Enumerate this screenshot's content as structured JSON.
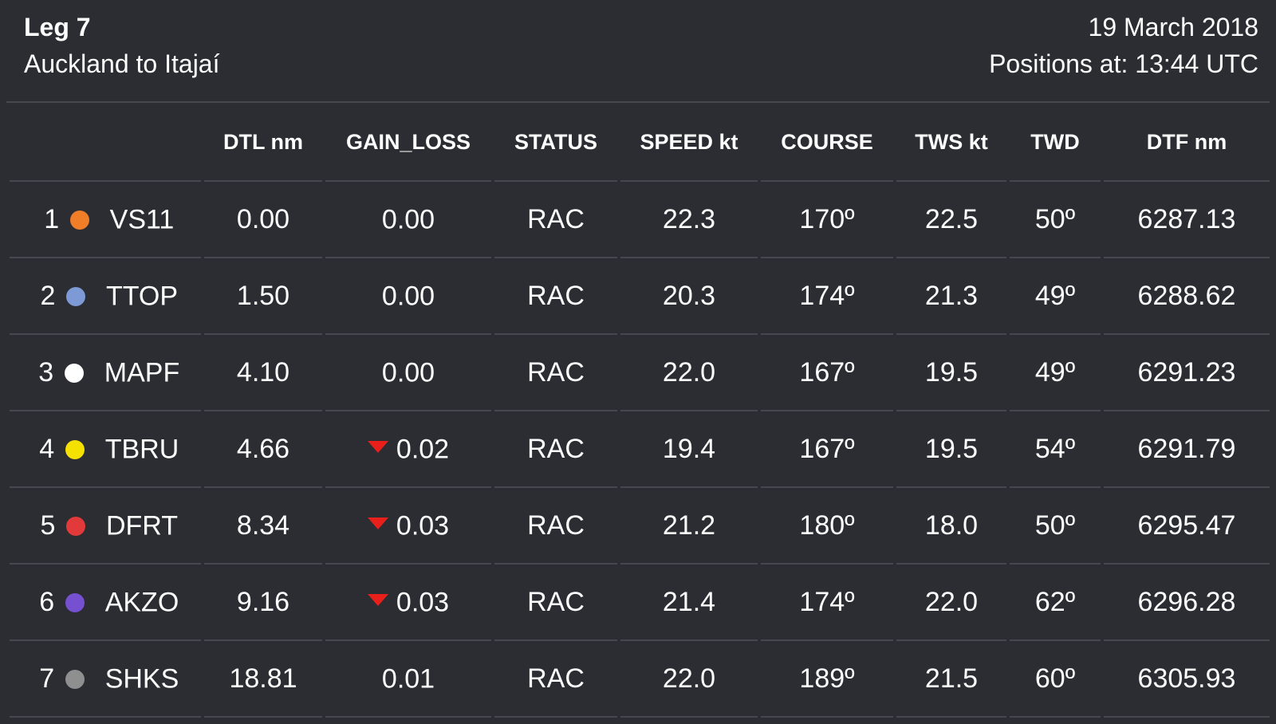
{
  "header": {
    "leg": "Leg 7",
    "route": "Auckland to Itajaí",
    "date": "19 March 2018",
    "positions_at": "Positions at: 13:44 UTC"
  },
  "columns": [
    "DTL nm",
    "GAIN_LOSS",
    "STATUS",
    "SPEED kt",
    "COURSE",
    "TWS kt",
    "TWD",
    "DTF nm"
  ],
  "rows": [
    {
      "rank": "1",
      "boat": "VS11",
      "color": "#f07d28",
      "dtl": "0.00",
      "gain_loss": "0.00",
      "loss": false,
      "status": "RAC",
      "speed": "22.3",
      "course": "170º",
      "tws": "22.5",
      "twd": "50º",
      "dtf": "6287.13"
    },
    {
      "rank": "2",
      "boat": "TTOP",
      "color": "#7e9ad6",
      "dtl": "1.50",
      "gain_loss": "0.00",
      "loss": false,
      "status": "RAC",
      "speed": "20.3",
      "course": "174º",
      "tws": "21.3",
      "twd": "49º",
      "dtf": "6288.62"
    },
    {
      "rank": "3",
      "boat": "MAPF",
      "color": "#ffffff",
      "dtl": "4.10",
      "gain_loss": "0.00",
      "loss": false,
      "status": "RAC",
      "speed": "22.0",
      "course": "167º",
      "tws": "19.5",
      "twd": "49º",
      "dtf": "6291.23"
    },
    {
      "rank": "4",
      "boat": "TBRU",
      "color": "#f5e100",
      "dtl": "4.66",
      "gain_loss": "0.02",
      "loss": true,
      "status": "RAC",
      "speed": "19.4",
      "course": "167º",
      "tws": "19.5",
      "twd": "54º",
      "dtf": "6291.79"
    },
    {
      "rank": "5",
      "boat": "DFRT",
      "color": "#e23a3a",
      "dtl": "8.34",
      "gain_loss": "0.03",
      "loss": true,
      "status": "RAC",
      "speed": "21.2",
      "course": "180º",
      "tws": "18.0",
      "twd": "50º",
      "dtf": "6295.47"
    },
    {
      "rank": "6",
      "boat": "AKZO",
      "color": "#7550d0",
      "dtl": "9.16",
      "gain_loss": "0.03",
      "loss": true,
      "status": "RAC",
      "speed": "21.4",
      "course": "174º",
      "tws": "22.0",
      "twd": "62º",
      "dtf": "6296.28"
    },
    {
      "rank": "7",
      "boat": "SHKS",
      "color": "#8f8f8f",
      "dtl": "18.81",
      "gain_loss": "0.01",
      "loss": false,
      "status": "RAC",
      "speed": "22.0",
      "course": "189º",
      "tws": "21.5",
      "twd": "60º",
      "dtf": "6305.93"
    }
  ],
  "colors": {
    "background": "#2b2d33",
    "divider": "#454850",
    "loss_indicator": "#e8201c"
  },
  "icons": {
    "loss": "down-triangle-icon",
    "boat_marker": "boat-color-dot-icon"
  }
}
